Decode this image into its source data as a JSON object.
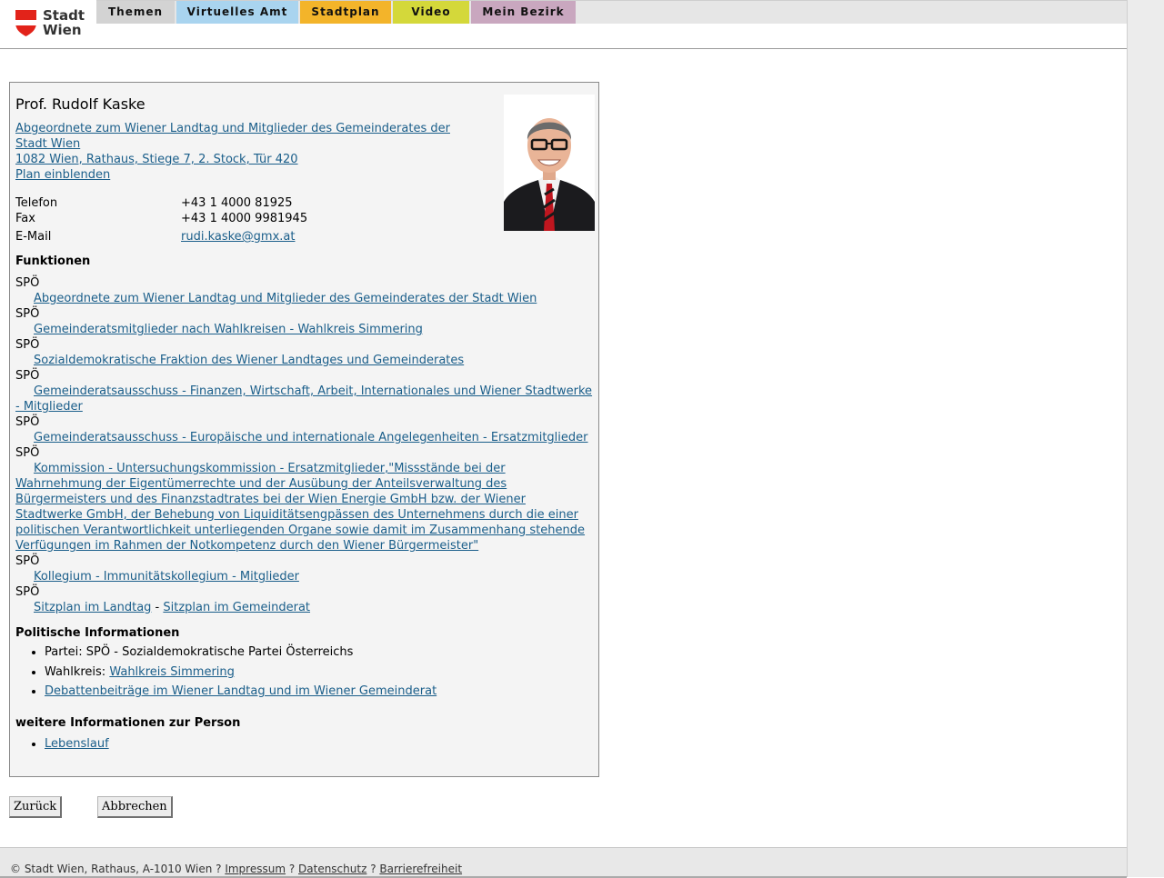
{
  "logo": {
    "line1": "Stadt",
    "line2": "Wien"
  },
  "nav": {
    "tabs": [
      {
        "label": "Themen",
        "color": "#d3d3d3"
      },
      {
        "label": "Virtuelles Amt",
        "color": "#a9d4ef"
      },
      {
        "label": "Stadtplan",
        "color": "#f3b42a"
      },
      {
        "label": "Video",
        "color": "#d4d83a"
      },
      {
        "label": "Mein Bezirk",
        "color": "#c9a7bf"
      }
    ]
  },
  "person": {
    "name": "Prof. Rudolf Kaske",
    "org_link": "Abgeordnete zum Wiener Landtag und Mitglieder des Gemeinderates der Stadt Wien ",
    "address_link": "1082 Wien, Rathaus, Stiege 7, 2. Stock, Tür 420",
    "plan_link": "Plan einblenden"
  },
  "contact": {
    "phone_label": "Telefon",
    "phone": "+43 1 4000 81925",
    "fax_label": "Fax",
    "fax": "+43 1 4000 9981945",
    "email_label": "E-Mail",
    "email": "rudi.kaske@gmx.at"
  },
  "functions": {
    "heading": "Funktionen",
    "items": [
      {
        "party": "SPÖ",
        "text": "Abgeordnete zum Wiener Landtag und Mitglieder des Gemeinderates der Stadt Wien"
      },
      {
        "party": "SPÖ",
        "text": "Gemeinderatsmitglieder nach Wahlkreisen - Wahlkreis Simmering"
      },
      {
        "party": "SPÖ",
        "text": "Sozialdemokratische Fraktion des Wiener Landtages und Gemeinderates"
      },
      {
        "party": "SPÖ",
        "text": "Gemeinderatsausschuss - Finanzen, Wirtschaft, Arbeit, Internationales und Wiener Stadtwerke - Mitglieder"
      },
      {
        "party": "SPÖ",
        "text": "Gemeinderatsausschuss - Europäische und internationale Angelegenheiten - Ersatzmitglieder"
      },
      {
        "party": "SPÖ",
        "text": "Kommission - Untersuchungskommission - Ersatzmitglieder,\"Missstände bei der Wahrnehmung der Eigentümerrechte und der Ausübung der Anteilsverwaltung des Bürgermeisters und des Finanzstadtrates bei der Wien Energie GmbH bzw. der Wiener Stadtwerke GmbH, der Behebung von Liquiditätsengpässen des Unternehmens durch die einer politischen Verantwortlichkeit unterliegenden Organe sowie damit im Zusammenhang stehende Verfügungen im Rahmen der Notkompetenz durch den Wiener Bürgermeister\""
      },
      {
        "party": "SPÖ",
        "text": "Kollegium - Immunitätskollegium - Mitglieder"
      }
    ],
    "seat_party": "SPÖ",
    "seat_landtag": "Sitzplan im Landtag",
    "seat_separator": " - ",
    "seat_gemeinderat": "Sitzplan im Gemeinderat"
  },
  "political": {
    "heading": "Politische Informationen",
    "party_text": "Partei: SPÖ - Sozialdemokratische Partei Österreichs",
    "district_label": "Wahlkreis: ",
    "district_link": "Wahlkreis Simmering",
    "debates_link": "Debattenbeiträge im Wiener Landtag und im Wiener Gemeinderat"
  },
  "more_info": {
    "heading": "weitere Informationen zur Person",
    "cv_link": "Lebenslauf"
  },
  "buttons": {
    "back": "Zurück",
    "cancel": "Abbrechen"
  },
  "footer": {
    "copyright": "© Stadt Wien, Rathaus, A-1010 Wien ? ",
    "impressum": "Impressum",
    "sep1": " ? ",
    "datenschutz": "Datenschutz",
    "sep2": " ? ",
    "barrierefreiheit": "Barrierefreiheit"
  }
}
